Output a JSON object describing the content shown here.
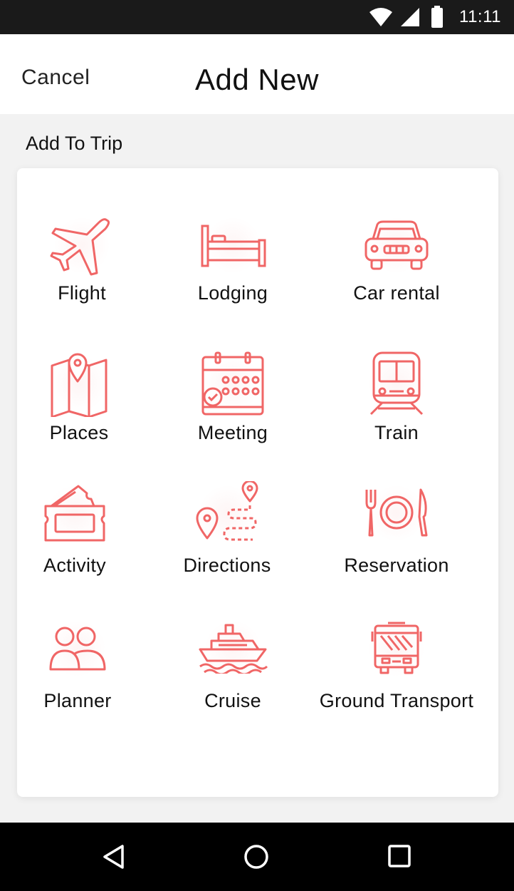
{
  "status_bar": {
    "time": "11:11",
    "icons": [
      "wifi-icon",
      "signal-icon",
      "battery-icon"
    ]
  },
  "header": {
    "cancel_label": "Cancel",
    "title": "Add New"
  },
  "section": {
    "label": "Add To Trip"
  },
  "accent_color": "#f06666",
  "items": [
    {
      "label": "Flight",
      "icon": "plane-icon"
    },
    {
      "label": "Lodging",
      "icon": "bed-icon"
    },
    {
      "label": "Car rental",
      "icon": "car-icon"
    },
    {
      "label": "Places",
      "icon": "map-pin-icon"
    },
    {
      "label": "Meeting",
      "icon": "calendar-icon"
    },
    {
      "label": "Train",
      "icon": "train-icon"
    },
    {
      "label": "Activity",
      "icon": "ticket-icon"
    },
    {
      "label": "Directions",
      "icon": "route-icon"
    },
    {
      "label": "Reservation",
      "icon": "dining-icon"
    },
    {
      "label": "Planner",
      "icon": "people-icon"
    },
    {
      "label": "Cruise",
      "icon": "ship-icon"
    },
    {
      "label": "Ground Transport",
      "icon": "bus-icon"
    }
  ],
  "nav": {
    "buttons": [
      "back-icon",
      "home-icon",
      "recents-icon"
    ]
  }
}
